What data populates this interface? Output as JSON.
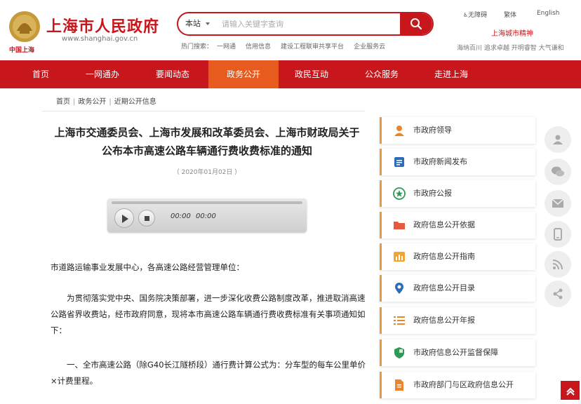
{
  "header": {
    "logo_caption": "中国上海",
    "site_title": "上海市人民政府",
    "site_url": "www.shanghai.gov.cn",
    "search": {
      "scope": "本站",
      "placeholder": "请输入关键字查询"
    },
    "hot_search": {
      "label": "热门搜索：",
      "items": [
        "一网通",
        "信用信息",
        "建设工程联审共享平台",
        "企业服务云"
      ]
    },
    "top_links": [
      "无障碍",
      "繁体",
      "English"
    ],
    "spirit_title": "上海城市精神",
    "spirit_sub": "海纳百川 追求卓越 开明睿智 大气谦和"
  },
  "nav": {
    "items": [
      "首页",
      "一网通办",
      "要闻动态",
      "政务公开",
      "政民互动",
      "公众服务",
      "走进上海"
    ],
    "active_index": 3,
    "colors": {
      "bar": "#c8161d",
      "active": "#e85b1f"
    }
  },
  "breadcrumb": [
    "首页",
    "政务公开",
    "近期公开信息"
  ],
  "article": {
    "title_line1": "上海市交通委员会、上海市发展和改革委员会、上海市财政局关于",
    "title_line2": "公布本市高速公路车辆通行费收费标准的通知",
    "date": "（ 2020年01月02日 ）",
    "player": {
      "current_time": "00:00",
      "duration": "00:00"
    },
    "paragraphs": [
      "市道路运输事业发展中心，各高速公路经营管理单位：",
      "为贯彻落实党中央、国务院决策部署，进一步深化收费公路制度改革，推进取消高速公路省界收费站，经市政府同意，现将本市高速公路车辆通行费收费标准有关事项通知如下：",
      "一、全市高速公路（除G40长江隧桥段）通行费计算公式为：分车型的每车公里单价×计费里程。"
    ]
  },
  "sidebar": {
    "items": [
      {
        "label": "市政府领导",
        "icon": "person-icon"
      },
      {
        "label": "市政府新闻发布",
        "icon": "document-icon"
      },
      {
        "label": "市政府公报",
        "icon": "star-icon"
      },
      {
        "label": "政府信息公开依据",
        "icon": "folder-icon"
      },
      {
        "label": "政府信息公开指南",
        "icon": "chart-icon"
      },
      {
        "label": "政府信息公开目录",
        "icon": "location-pin-icon"
      },
      {
        "label": "政府信息公开年报",
        "icon": "list-icon"
      },
      {
        "label": "市政府信息公开监督保障",
        "icon": "shield-icon"
      },
      {
        "label": "市政府部门与区政府信息公开",
        "icon": "file-icon"
      }
    ]
  },
  "share": [
    "contact-icon",
    "wechat-icon",
    "mail-icon",
    "mobile-icon",
    "rss-icon",
    "share-icon"
  ]
}
